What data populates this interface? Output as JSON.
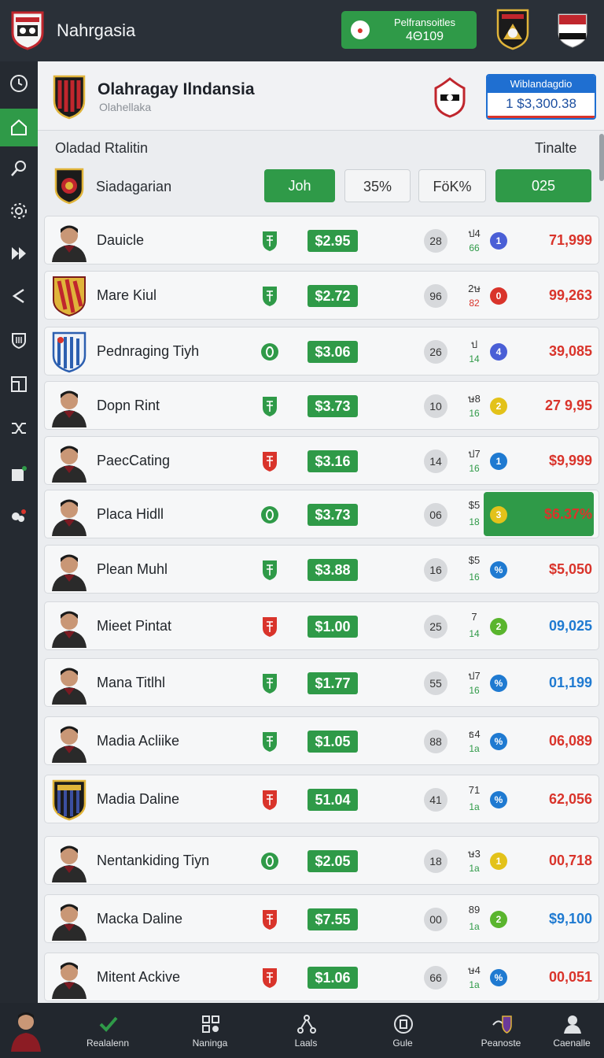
{
  "app": {
    "title": "Nahrgasia"
  },
  "topbar": {
    "balance_label": "Pelfransoitles",
    "balance_value": "4Θ109"
  },
  "league": {
    "name": "Olahragay Ilndansia",
    "subtitle": "Olahellaka"
  },
  "rank_box": {
    "label": "Wiblandagdio",
    "value": "1 $3,300.38"
  },
  "section": {
    "title": "Oladad Rtalitin",
    "right": "Tinalte"
  },
  "filter": {
    "label": "Siadagarian",
    "btn1": "Joh",
    "btn2": "35%",
    "btn3": "FöK%",
    "btn4": "025"
  },
  "colors": {
    "accent_green": "#2f9a48",
    "red": "#d9342b",
    "blue": "#1f7ad1",
    "dark_bg": "#2a3038"
  },
  "players": [
    {
      "name": "Dauicle",
      "price": "$2.95",
      "rating": "28",
      "form_top": "ป4",
      "form_bot": "66",
      "dot": "1",
      "dot_color": "#4a5fd6",
      "points": "71,999",
      "pos_icon": "green-shield-icon",
      "avatar": "player-photo"
    },
    {
      "name": "Mare Kiul",
      "price": "$2.72",
      "rating": "96",
      "form_top": "2ษ",
      "form_bot": "82",
      "dot": "0",
      "dot_color": "#d9342b",
      "points": "99,263",
      "pos_icon": "green-shield-icon",
      "avatar": "club-crest-yellow-red"
    },
    {
      "name": "Pednraging Tiyh",
      "price": "$3.06",
      "rating": "26",
      "form_top": "ป",
      "form_bot": "14",
      "dot": "4",
      "dot_color": "#4a5fd6",
      "points": "39,085",
      "pos_icon": "green-circle-icon",
      "avatar": "club-crest-blue"
    },
    {
      "name": "Dopn Rint",
      "price": "$3.73",
      "rating": "10",
      "form_top": "ษ8",
      "form_bot": "16",
      "dot": "2",
      "dot_color": "#e3c21a",
      "points": "27 9,95",
      "pos_icon": "green-shield-icon",
      "avatar": "player-photo"
    },
    {
      "name": "PaecCating",
      "price": "$3.16",
      "rating": "14",
      "form_top": "ป7",
      "form_bot": "16",
      "dot": "1",
      "dot_color": "#1f7ad1",
      "points": "$9,999",
      "pos_icon": "red-shield-icon",
      "avatar": "player-photo"
    },
    {
      "name": "Placa Hidll",
      "price": "$3.73",
      "rating": "06",
      "form_top": "$5",
      "form_bot": "18",
      "dot": "3",
      "dot_color": "#e3c21a",
      "points": "$6.37%",
      "pos_icon": "green-circle-icon",
      "avatar": "player-photo",
      "highlight": true
    },
    {
      "name": "Plean Muhl",
      "price": "$3.88",
      "rating": "16",
      "form_top": "$5",
      "form_bot": "16",
      "dot": "%",
      "dot_color": "#1f7ad1",
      "points": "$5,050",
      "pos_icon": "green-shield-icon",
      "avatar": "player-photo"
    },
    {
      "name": "Mieet Pintat",
      "price": "$1.00",
      "rating": "25",
      "form_top": "7",
      "form_bot": "14",
      "dot": "2",
      "dot_color": "#5ab52e",
      "points": "09,025",
      "points_color": "blue",
      "pos_icon": "red-shield-icon",
      "avatar": "player-photo"
    },
    {
      "name": "Mana Titlhl",
      "price": "$1.77",
      "rating": "55",
      "form_top": "ป7",
      "form_bot": "16",
      "dot": "%",
      "dot_color": "#1f7ad1",
      "points": "01,199",
      "points_color": "blue",
      "pos_icon": "green-shield-icon",
      "avatar": "player-photo"
    },
    {
      "name": "Madia Acliike",
      "price": "$1.05",
      "rating": "88",
      "form_top": "ธ4",
      "form_bot": "1a",
      "dot": "%",
      "dot_color": "#1f7ad1",
      "points": "06,089",
      "pos_icon": "green-shield-icon",
      "avatar": "player-photo"
    },
    {
      "name": "Madia Daline",
      "price": "51.04",
      "rating": "41",
      "form_top": "71",
      "form_bot": "1a",
      "dot": "%",
      "dot_color": "#1f7ad1",
      "points": "62,056",
      "pos_icon": "red-shield-icon",
      "avatar": "club-crest-dark"
    },
    {
      "name": "Nentankiding Tiyn",
      "price": "$2.05",
      "rating": "18",
      "form_top": "ษ3",
      "form_bot": "1a",
      "dot": "1",
      "dot_color": "#e3c21a",
      "points": "00,718",
      "pos_icon": "green-circle-icon",
      "avatar": "player-photo"
    },
    {
      "name": "Macka Daline",
      "price": "$7.55",
      "rating": "00",
      "form_top": "89",
      "form_bot": "1a",
      "dot": "2",
      "dot_color": "#5ab52e",
      "points": "$9,100",
      "points_color": "blue",
      "pos_icon": "red-shield-icon",
      "avatar": "player-photo"
    },
    {
      "name": "Mitent Ackive",
      "price": "$1.06",
      "rating": "66",
      "form_top": "ษ4",
      "form_bot": "1a",
      "dot": "%",
      "dot_color": "#1f7ad1",
      "points": "00,051",
      "pos_icon": "red-shield-icon",
      "avatar": "player-photo"
    }
  ],
  "bottom_nav": [
    {
      "label": "Realalenn",
      "icon": "check-icon"
    },
    {
      "label": "Naninga",
      "icon": "grid-icon"
    },
    {
      "label": "Laals",
      "icon": "network-icon"
    },
    {
      "label": "Gule",
      "icon": "coin-icon"
    },
    {
      "label": "Peanoste",
      "icon": "trophy-icon"
    },
    {
      "label": "Caenalle",
      "icon": "person-icon"
    }
  ]
}
